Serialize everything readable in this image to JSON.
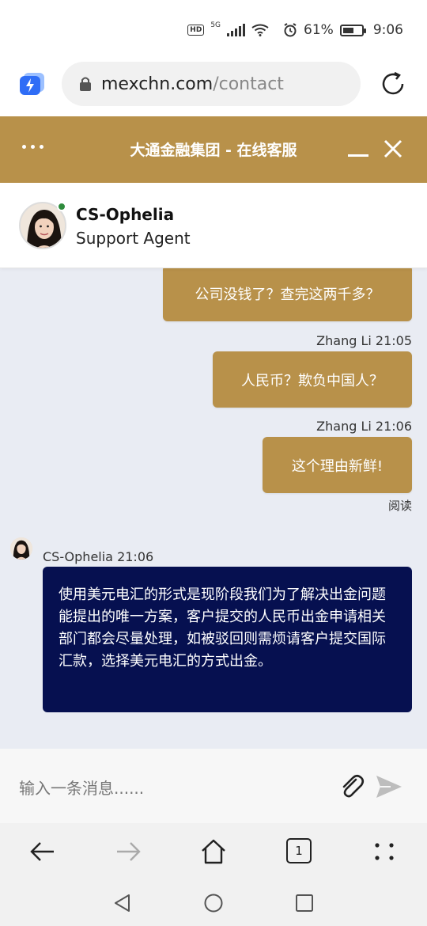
{
  "status_bar": {
    "network": "5G",
    "hd": "HD",
    "battery": "61%",
    "battery_level": 0.61,
    "time": "9:06"
  },
  "browser": {
    "domain": "mexchn.com",
    "path": "/contact"
  },
  "chat_header": {
    "title": "大通金融集团 - 在线客服"
  },
  "agent": {
    "name": "CS-Ophelia",
    "role": "Support Agent",
    "online": true
  },
  "messages": [
    {
      "sender": "user",
      "text": "公司没钱了？查完这两千多？"
    },
    {
      "sender": "user",
      "meta": "Zhang Li 21:05",
      "text": "人民币？欺负中国人？"
    },
    {
      "sender": "user",
      "meta": "Zhang Li 21:06",
      "text": "这个理由新鲜!",
      "status": "阅读"
    },
    {
      "sender": "agent",
      "meta": "CS-Ophelia 21:06",
      "text": "使用美元电汇的形式是现阶段我们为了解决出金问题能提出的唯一方案，客户提交的人民币出金申请相关部门都会尽量处理，如被驳回则需烦请客户提交国际汇款，选择美元电汇的方式出金。"
    }
  ],
  "input": {
    "placeholder": "输入一条消息......"
  },
  "browser_nav": {
    "tab_count": "1"
  },
  "colors": {
    "accent": "#b8914a",
    "agent_bubble": "#061050",
    "chat_bg": "#e9ecf3",
    "online": "#2e8b3c"
  }
}
